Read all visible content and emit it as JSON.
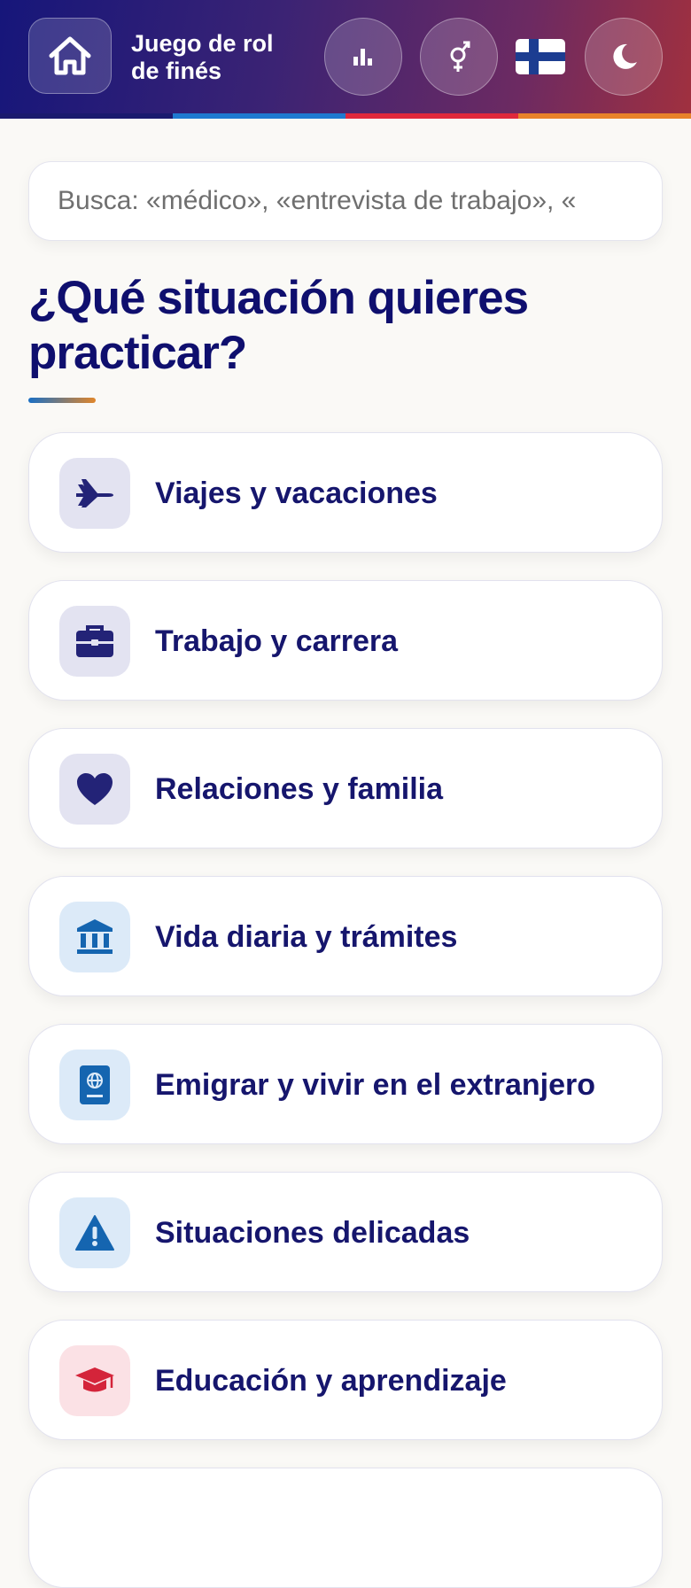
{
  "header": {
    "title_line1": "Juego de rol",
    "title_line2": "de finés",
    "stripe_colors": [
      "#1a1a6e",
      "#1e7ad0",
      "#e0283c",
      "#e8822a"
    ]
  },
  "search": {
    "placeholder": "Busca: «médico», «entrevista de trabajo», «"
  },
  "heading": "¿Qué situación quieres practicar?",
  "categories": [
    {
      "label": "Viajes y vacaciones",
      "icon": "airplane-icon",
      "bg": "#e3e3f1",
      "fg": "#232377"
    },
    {
      "label": "Trabajo y carrera",
      "icon": "briefcase-icon",
      "bg": "#e3e3f1",
      "fg": "#232377"
    },
    {
      "label": "Relaciones y familia",
      "icon": "heart-icon",
      "bg": "#e3e3f1",
      "fg": "#232377"
    },
    {
      "label": "Vida diaria y trámites",
      "icon": "bank-icon",
      "bg": "#dceaf8",
      "fg": "#1565b0"
    },
    {
      "label": "Emigrar y vivir en el extranjero",
      "icon": "passport-icon",
      "bg": "#dceaf8",
      "fg": "#1565b0"
    },
    {
      "label": "Situaciones delicadas",
      "icon": "warning-icon",
      "bg": "#dceaf8",
      "fg": "#1565b0"
    },
    {
      "label": "Educación y aprendizaje",
      "icon": "graduation-cap-icon",
      "bg": "#fbe1e5",
      "fg": "#d4243a"
    }
  ]
}
